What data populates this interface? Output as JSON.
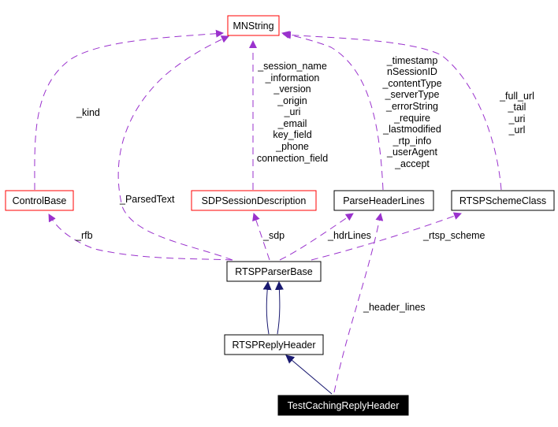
{
  "diagram": {
    "type": "collaboration-graph",
    "colors": {
      "usage_edge": "#9a32cd",
      "inheritance_edge": "#191970",
      "external_border": "#ff0000",
      "normal_border": "#000000",
      "focus_fill": "#000000",
      "focus_text": "#ffffff"
    },
    "nodes": {
      "mnstring": {
        "label": "MNString",
        "kind": "external"
      },
      "controlbase": {
        "label": "ControlBase",
        "kind": "external"
      },
      "sdp": {
        "label": "SDPSessionDescription",
        "kind": "external"
      },
      "parseheaderlines": {
        "label": "ParseHeaderLines",
        "kind": "normal"
      },
      "rtspschemeclass": {
        "label": "RTSPSchemeClass",
        "kind": "normal"
      },
      "rtspparserbase": {
        "label": "RTSPParserBase",
        "kind": "normal"
      },
      "rtspreplyheader": {
        "label": "RTSPReplyHeader",
        "kind": "normal"
      },
      "testcaching": {
        "label": "TestCachingReplyHeader",
        "kind": "focus"
      }
    },
    "edges": {
      "kind": {
        "from": "ControlBase",
        "to": "MNString",
        "labels": [
          "_kind"
        ]
      },
      "parsedtext": {
        "from": "RTSPParserBase",
        "to": "MNString",
        "labels": [
          "_ParsedText"
        ]
      },
      "sdpfields": {
        "from": "SDPSessionDescription",
        "to": "MNString",
        "labels": [
          "_session_name",
          "_information",
          "_version",
          "_origin",
          "_uri",
          "_email",
          "key_field",
          "_phone",
          "connection_field"
        ]
      },
      "headerfields": {
        "from": "ParseHeaderLines",
        "to": "MNString",
        "labels": [
          "_timestamp",
          "nSessionID",
          "_contentType",
          "_serverType",
          "_errorString",
          "_require",
          "_lastmodified",
          "_rtp_info",
          "_userAgent",
          "_accept"
        ]
      },
      "schemefields": {
        "from": "RTSPSchemeClass",
        "to": "MNString",
        "labels": [
          "_full_url",
          "_tail",
          "_uri",
          "_url"
        ]
      },
      "rfb": {
        "from": "RTSPParserBase",
        "to": "ControlBase",
        "labels": [
          "_rfb"
        ]
      },
      "sdp": {
        "from": "RTSPParserBase",
        "to": "SDPSessionDescription",
        "labels": [
          "_sdp"
        ]
      },
      "hdrlines": {
        "from": "RTSPParserBase",
        "to": "ParseHeaderLines",
        "labels": [
          "_hdrLines"
        ]
      },
      "rtspscheme": {
        "from": "RTSPParserBase",
        "to": "RTSPSchemeClass",
        "labels": [
          "_rtsp_scheme"
        ]
      },
      "headerlines": {
        "from": "TestCachingReplyHeader",
        "to": "ParseHeaderLines",
        "labels": [
          "_header_lines"
        ]
      },
      "inherit1": {
        "from": "RTSPReplyHeader",
        "to": "RTSPParserBase",
        "labels": []
      },
      "inherit2": {
        "from": "TestCachingReplyHeader",
        "to": "RTSPReplyHeader",
        "labels": []
      }
    }
  }
}
